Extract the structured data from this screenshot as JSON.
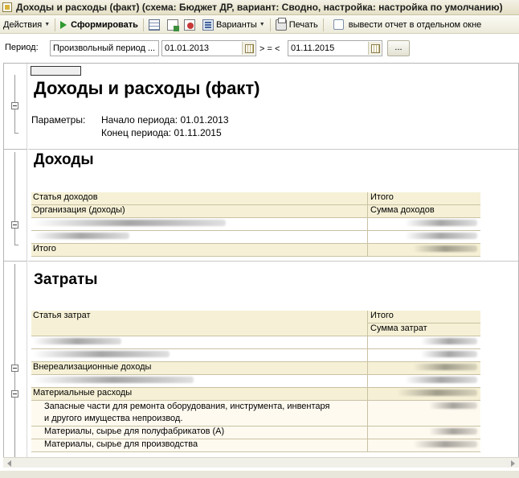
{
  "window": {
    "title": "Доходы и расходы (факт) (схема: Бюджет ДР, вариант: Сводно, настройка: настройка по умолчанию)"
  },
  "toolbar": {
    "actions_label": "Действия",
    "generate_label": "Сформировать",
    "variants_label": "Варианты",
    "print_label": "Печать",
    "separate_window_label": "вывести отчет в отдельном окне"
  },
  "period": {
    "label": "Период:",
    "type_value": "Произвольный период ...",
    "from_value": "01.01.2013",
    "separator": "> = <",
    "to_value": "01.11.2015",
    "more_button": "..."
  },
  "report": {
    "title": "Доходы и расходы (факт)",
    "params_label": "Параметры:",
    "period_start": "Начало периода: 01.01.2013",
    "period_end": "Конец периода: 01.11.2015",
    "income": {
      "heading": "Доходы",
      "col1_header": "Статья доходов",
      "col2_header": "Итого",
      "col1_subheader": "Организация (доходы)",
      "col2_subheader": "Сумма доходов",
      "total_label": "Итого"
    },
    "costs": {
      "heading": "Затраты",
      "col1_header": "Статья затрат",
      "col2_header": "Итого",
      "col2_subheader": "Сумма затрат",
      "rows": [
        {
          "label": "Внереализационные доходы"
        },
        {
          "label": "Материальные расходы"
        },
        {
          "label": "Запасные части для ремонта оборудования, инструмента, инвентаря"
        },
        {
          "label": "и другого имущества непроизвод."
        },
        {
          "label": "Материалы, сырье для полуфабрикатов (А)"
        },
        {
          "label": "Материалы, сырье для производства"
        }
      ]
    }
  }
}
